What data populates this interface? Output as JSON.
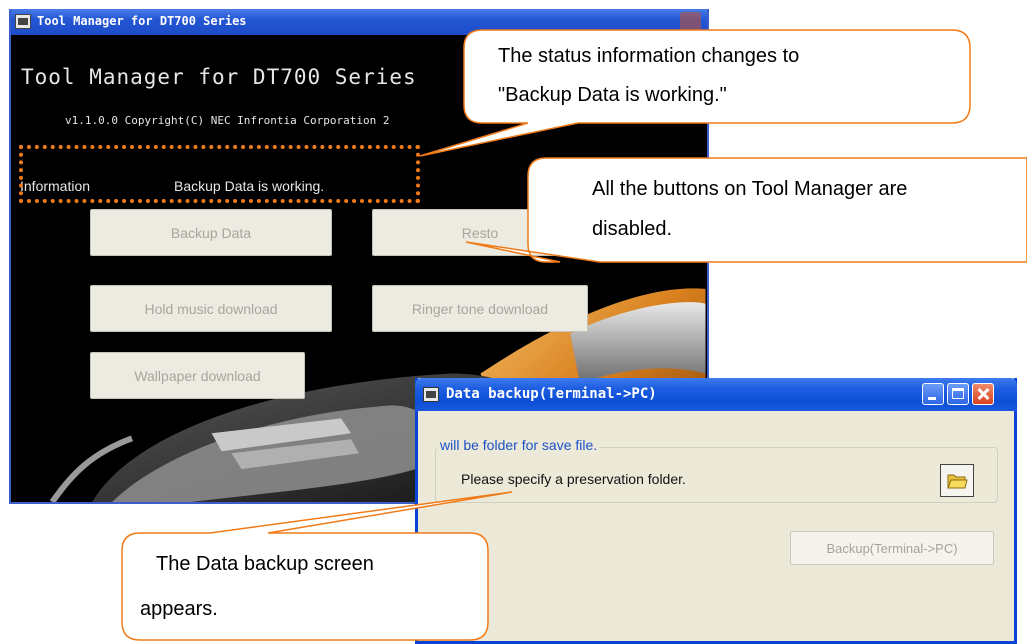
{
  "tool_manager": {
    "title": "Tool Manager for DT700 Series",
    "heading": "Tool Manager for DT700 Series",
    "version": "v1.1.0.0 Copyright(C) NEC Infrontia Corporation 2",
    "info_label": "Information",
    "info_value": "Backup Data is working.",
    "buttons": {
      "backup": "Backup Data",
      "restore": "Resto",
      "hold_music": "Hold music download",
      "ringer": "Ringer tone download",
      "wallpaper": "Wallpaper download"
    }
  },
  "data_backup": {
    "title": "Data backup(Terminal->PC)",
    "group_label": "will be folder for save file.",
    "group_text": "Please specify a preservation folder.",
    "backup_button": "Backup(Terminal->PC)"
  },
  "callouts": {
    "status": [
      "The status information changes to",
      "\"Backup Data is working.\""
    ],
    "buttons": [
      "All the buttons on Tool Manager are",
      "disabled."
    ],
    "screen": [
      "The Data backup screen",
      "appears."
    ]
  },
  "colors": {
    "highlight": "#f07a18",
    "xp_title_blue": "#0c4fd8",
    "dialog_bg": "#ece9d8"
  }
}
